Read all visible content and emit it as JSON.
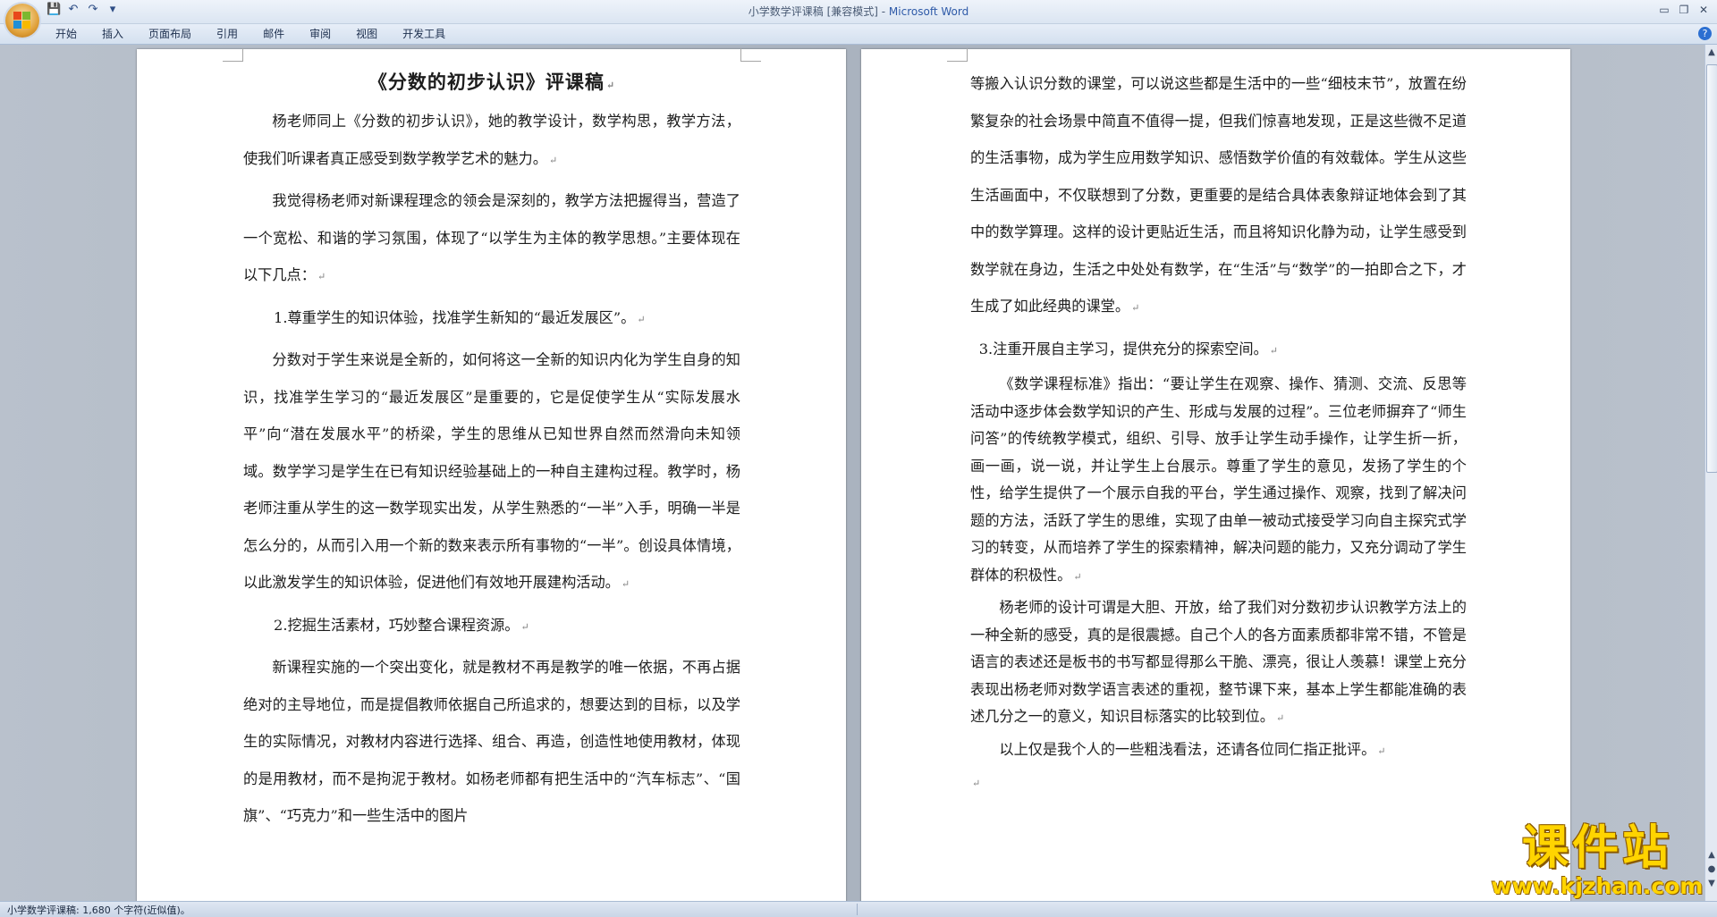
{
  "window": {
    "title_doc": "小学数学评课稿 [兼容模式] - ",
    "title_app": "Microsoft Word",
    "controls": [
      "▭",
      "❐",
      "✕"
    ]
  },
  "qat": {
    "save": "💾",
    "undo": "↶",
    "redo": "↷",
    "more": "▾"
  },
  "ribbon": {
    "tabs": [
      "开始",
      "插入",
      "页面布局",
      "引用",
      "邮件",
      "审阅",
      "视图",
      "开发工具"
    ],
    "help": "?"
  },
  "left_page": {
    "title": "《分数的初步认识》评课稿",
    "p1": "杨老师同上《分数的初步认识》，她的教学设计，数学构思，教学方法，使我们听课者真正感受到数学教学艺术的魅力。",
    "p2": "我觉得杨老师对新课程理念的领会是深刻的，教学方法把握得当，营造了一个宽松、和谐的学习氛围，体现了“以学生为主体的教学思想。”主要体现在以下几点：",
    "h1": "1.尊重学生的知识体验，找准学生新知的“最近发展区”。",
    "p3": "分数对于学生来说是全新的，如何将这一全新的知识内化为学生自身的知识，找准学生学习的“最近发展区”是重要的，它是促使学生从“实际发展水平”向“潜在发展水平”的桥梁，学生的思维从已知世界自然而然滑向未知领域。数学学习是学生在已有知识经验基础上的一种自主建构过程。教学时，杨老师注重从学生的这一数学现实出发，从学生熟悉的“一半”入手，明确一半是怎么分的，从而引入用一个新的数来表示所有事物的“一半”。创设具体情境，以此激发学生的知识体验，促进他们有效地开展建构活动。",
    "h2": "2.挖掘生活素材，巧妙整合课程资源。",
    "p4": "新课程实施的一个突出变化，就是教材不再是教学的唯一依据，不再占据绝对的主导地位，而是提倡教师依据自己所追求的，想要达到的目标，以及学生的实际情况，对教材内容进行选择、组合、再造，创造性地使用教材，体现的是用教材，而不是拘泥于教材。如杨老师都有把生活中的“汽车标志”、“国旗”、“巧克力”和一些生活中的图片"
  },
  "right_page": {
    "p1": "等搬入认识分数的课堂，可以说这些都是生活中的一些“细枝末节”，放置在纷繁复杂的社会场景中简直不值得一提，但我们惊喜地发现，正是这些微不足道的生活事物，成为学生应用数学知识、感悟数学价值的有效载体。学生从这些生活画面中，不仅联想到了分数，更重要的是结合具体表象辩证地体会到了其中的数学算理。这样的设计更贴近生活，而且将知识化静为动，让学生感受到数学就在身边，生活之中处处有数学，在“生活”与“数学”的一拍即合之下，才生成了如此经典的课堂。",
    "h3": "3.注重开展自主学习，提供充分的探索空间。",
    "p2": "《数学课程标准》指出：“要让学生在观察、操作、猜测、交流、反思等活动中逐步体会数学知识的产生、形成与发展的过程”。三位老师摒弃了“师生问答”的传统教学模式，组织、引导、放手让学生动手操作，让学生折一折，画一画，说一说，并让学生上台展示。尊重了学生的意见，发扬了学生的个性，给学生提供了一个展示自我的平台，学生通过操作、观察，找到了解决问题的方法，活跃了学生的思维，实现了由单一被动式接受学习向自主探究式学习的转变，从而培养了学生的探索精神，解决问题的能力，又充分调动了学生群体的积极性。",
    "p3": "杨老师的设计可谓是大胆、开放，给了我们对分数初步认识教学方法上的一种全新的感受，真的是很震撼。自己个人的各方面素质都非常不错，不管是语言的表述还是板书的书写都显得那么干脆、漂亮，很让人羡慕！课堂上充分表现出杨老师对数学语言表述的重视，整节课下来，基本上学生都能准确的表述几分之一的意义，知识目标落实的比较到位。",
    "p4": "以上仅是我个人的一些粗浅看法，还请各位同仁指正批评。"
  },
  "para_mark": "↵",
  "statusbar": {
    "text": "小学数学评课稿: 1,680 个字符(近似值)。"
  },
  "watermark": {
    "text": "课件站",
    "url": "www.kjzhan.com"
  },
  "colors": {
    "accent": "#2e5aa8",
    "watermark": "#ffd400"
  }
}
